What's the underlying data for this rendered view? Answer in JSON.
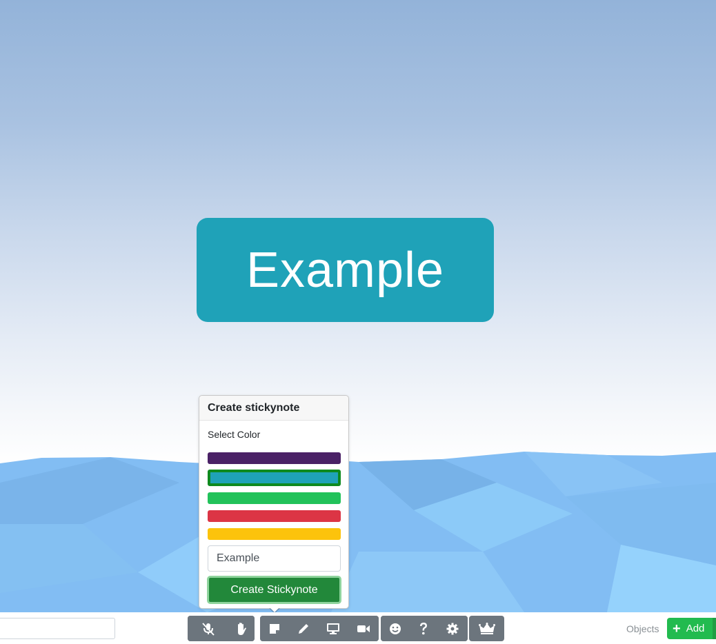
{
  "canvas": {
    "sticky_note": {
      "text": "Example",
      "color": "#1fa2b8"
    }
  },
  "popover": {
    "title": "Create stickynote",
    "select_color_label": "Select Color",
    "colors": [
      {
        "name": "purple",
        "hex": "#4a2166",
        "selected": false
      },
      {
        "name": "teal",
        "hex": "#1fa2b8",
        "selected": true
      },
      {
        "name": "green",
        "hex": "#22c25a",
        "selected": false
      },
      {
        "name": "red",
        "hex": "#dc3545",
        "selected": false
      },
      {
        "name": "yellow",
        "hex": "#fcc30c",
        "selected": false
      }
    ],
    "text_value": "Example",
    "create_button_label": "Create Stickynote"
  },
  "toolbar": {
    "chat_input_value": "",
    "groups": [
      {
        "name": "interaction",
        "buttons": [
          "mic-muted-icon",
          "raise-hand-icon"
        ]
      },
      {
        "name": "tools",
        "buttons": [
          "stickynote-icon",
          "pencil-icon",
          "screen-share-icon",
          "video-camera-icon"
        ]
      },
      {
        "name": "misc",
        "buttons": [
          "emoji-icon",
          "help-icon",
          "settings-icon"
        ]
      },
      {
        "name": "admin",
        "buttons": [
          "crown-icon"
        ]
      }
    ],
    "objects_label": "Objects",
    "add_button_label": "Add"
  }
}
